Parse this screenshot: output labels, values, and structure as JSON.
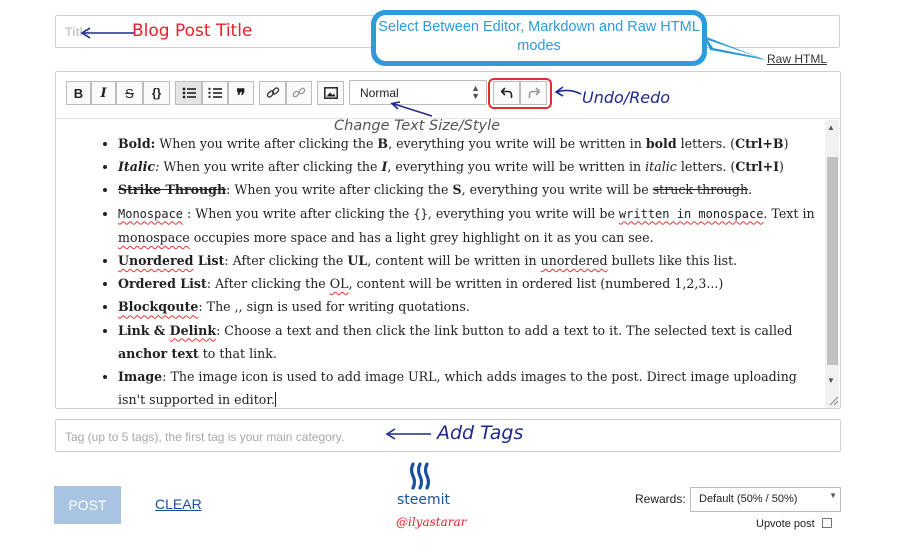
{
  "title_field": {
    "placeholder": "Title"
  },
  "callouts": {
    "title": "Blog Post Title",
    "modes": "Select Between Editor, Markdown and Raw HTML modes",
    "text_size": "Change Text Size/Style",
    "undo_redo": "Undo/Redo",
    "tags": "Add Tags"
  },
  "raw_html_link": "Raw HTML",
  "toolbar": {
    "bold": "B",
    "italic": "I",
    "strike": "S",
    "code": "{}",
    "size_select": "Normal"
  },
  "content": {
    "items": [
      {
        "label": "Bold:",
        "a": " When you write after clicking the ",
        "b": "B",
        "c": ", everything you write will be written in ",
        "d": "bold",
        "e": " letters. (",
        "f": "Ctrl+B",
        "g": ")"
      },
      {
        "label": "Italic",
        "colon": ":",
        "a": " When you write after  clicking the ",
        "b": "I",
        "c": ", everything you write will be written in ",
        "d": "italic",
        "e": " letters. (",
        "f": "Ctrl+I",
        "g": ")"
      },
      {
        "label": "Strike Through",
        "a": ": When you write after clicking the ",
        "b": "S",
        "c": ", everything you write will be ",
        "d": "struck through",
        "e": "."
      },
      {
        "label": "Monospace",
        "a": " :  When you write after clicking the ",
        "b": "{}",
        "c": ", everything you write will be ",
        "d": "written in monospace",
        "e": ". Text in ",
        "f": "monospace",
        "g": " occupies more space and has a light grey highlight on it as you can see."
      },
      {
        "label_a": "Unordered",
        "label_b": " List",
        "a": ": After clicking the ",
        "b": "UL",
        "c": ", content will be written in ",
        "d": "unordered",
        "e": " bullets like this list."
      },
      {
        "label": "Ordered List",
        "a": ": After clicking the ",
        "b": "OL",
        "c": ", content will be written in ordered list (numbered 1,2,3...)"
      },
      {
        "label": "Blockqoute",
        "a": ": The ,, sign is used for writing quotations."
      },
      {
        "label_a": "Link & ",
        "label_b": "Delink",
        "a": ": Choose a text and then click the link button to add a text to it. The selected text is called ",
        "b": "anchor text",
        "c": " to that link."
      },
      {
        "label": "Image",
        "a": ": The image icon is used to add image URL, which adds images to the post. Direct image uploading isn't supported in editor."
      }
    ]
  },
  "tags_field": {
    "placeholder": "Tag (up to 5 tags), the first tag is your main category."
  },
  "post_button": "POST",
  "clear_link": "CLEAR",
  "brand": {
    "name": "steemit",
    "handle": "@ilyastarar",
    "color": "#1a5099"
  },
  "rewards": {
    "label": "Rewards:",
    "selected": "Default (50% / 50%)"
  },
  "upvote": {
    "label": "Upvote post"
  },
  "colors": {
    "annotation_red": "#e8202a",
    "annotation_blue": "#1e2a8c",
    "callout_blue": "#2f9bd8"
  }
}
